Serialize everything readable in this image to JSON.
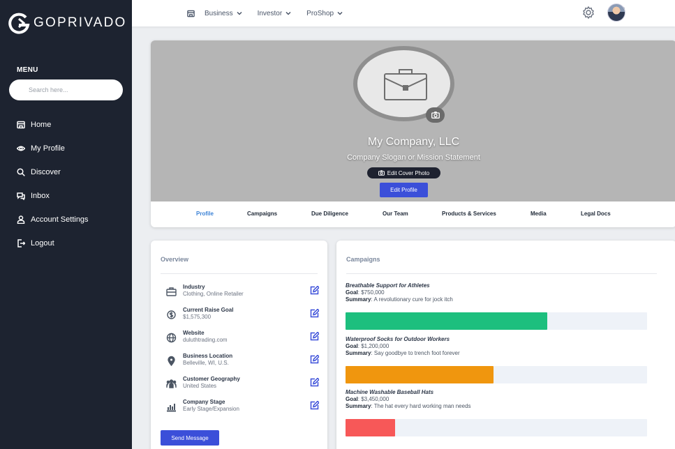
{
  "brand": {
    "name": "GOPRIVADO"
  },
  "sidebar": {
    "menu_heading": "MENU",
    "search_placeholder": "Search here...",
    "items": [
      {
        "label": "Home",
        "icon": "home-icon"
      },
      {
        "label": "My Profile",
        "icon": "eye-icon"
      },
      {
        "label": "Discover",
        "icon": "search-icon"
      },
      {
        "label": "Inbox",
        "icon": "chat-icon"
      },
      {
        "label": "Account Settings",
        "icon": "user-icon"
      },
      {
        "label": "Logout",
        "icon": "logout-icon"
      }
    ]
  },
  "topbar": {
    "menus": [
      {
        "label": "Business",
        "icon": "store-icon"
      },
      {
        "label": "Investor"
      },
      {
        "label": "ProShop"
      }
    ]
  },
  "profile": {
    "company_name": "My Company, LLC",
    "slogan": "Company Slogan or Mission Statement",
    "edit_cover_label": "Edit Cover Photo",
    "edit_profile_label": "Edit Profile",
    "tabs": [
      "Profile",
      "Campaigns",
      "Due Diligence",
      "Our Team",
      "Products & Services",
      "Media",
      "Legal Docs"
    ],
    "active_tab": "Profile"
  },
  "overview": {
    "title": "Overview",
    "rows": [
      {
        "label": "Industry",
        "value": "Clothing, Online Retailer",
        "icon": "briefcase-icon"
      },
      {
        "label": "Current Raise Goal",
        "value": "$1,575,300",
        "icon": "dollar-icon"
      },
      {
        "label": "Website",
        "value": "duluthtrading.com",
        "icon": "globe-icon"
      },
      {
        "label": "Business Location",
        "value": "Belleville, WI, U.S.",
        "icon": "pin-icon"
      },
      {
        "label": "Customer Geography",
        "value": "United States",
        "icon": "people-icon"
      },
      {
        "label": "Company Stage",
        "value": "Early Stage/Expansion",
        "icon": "chart-icon"
      }
    ],
    "send_label": "Send Message"
  },
  "campaigns": {
    "title": "Campaigns",
    "goal_label": "Goal",
    "summary_label": "Summary",
    "items": [
      {
        "name": "Breathable Support for Athletes",
        "goal": "$750,000",
        "summary": "A revolutionary cure for jock itch",
        "progress": 0.67,
        "color": "#1dbf7e"
      },
      {
        "name": "Waterproof Socks for Outdoor Workers",
        "goal": "$1,200,000",
        "summary": "Say goodbye to trench foot forever",
        "progress": 0.49,
        "color": "#f0960e"
      },
      {
        "name": "Machine Washable Baseball Hats",
        "goal": "$3,450,000",
        "summary": "The hat every hard working man needs",
        "progress": 0.165,
        "color": "#f75858"
      }
    ]
  }
}
